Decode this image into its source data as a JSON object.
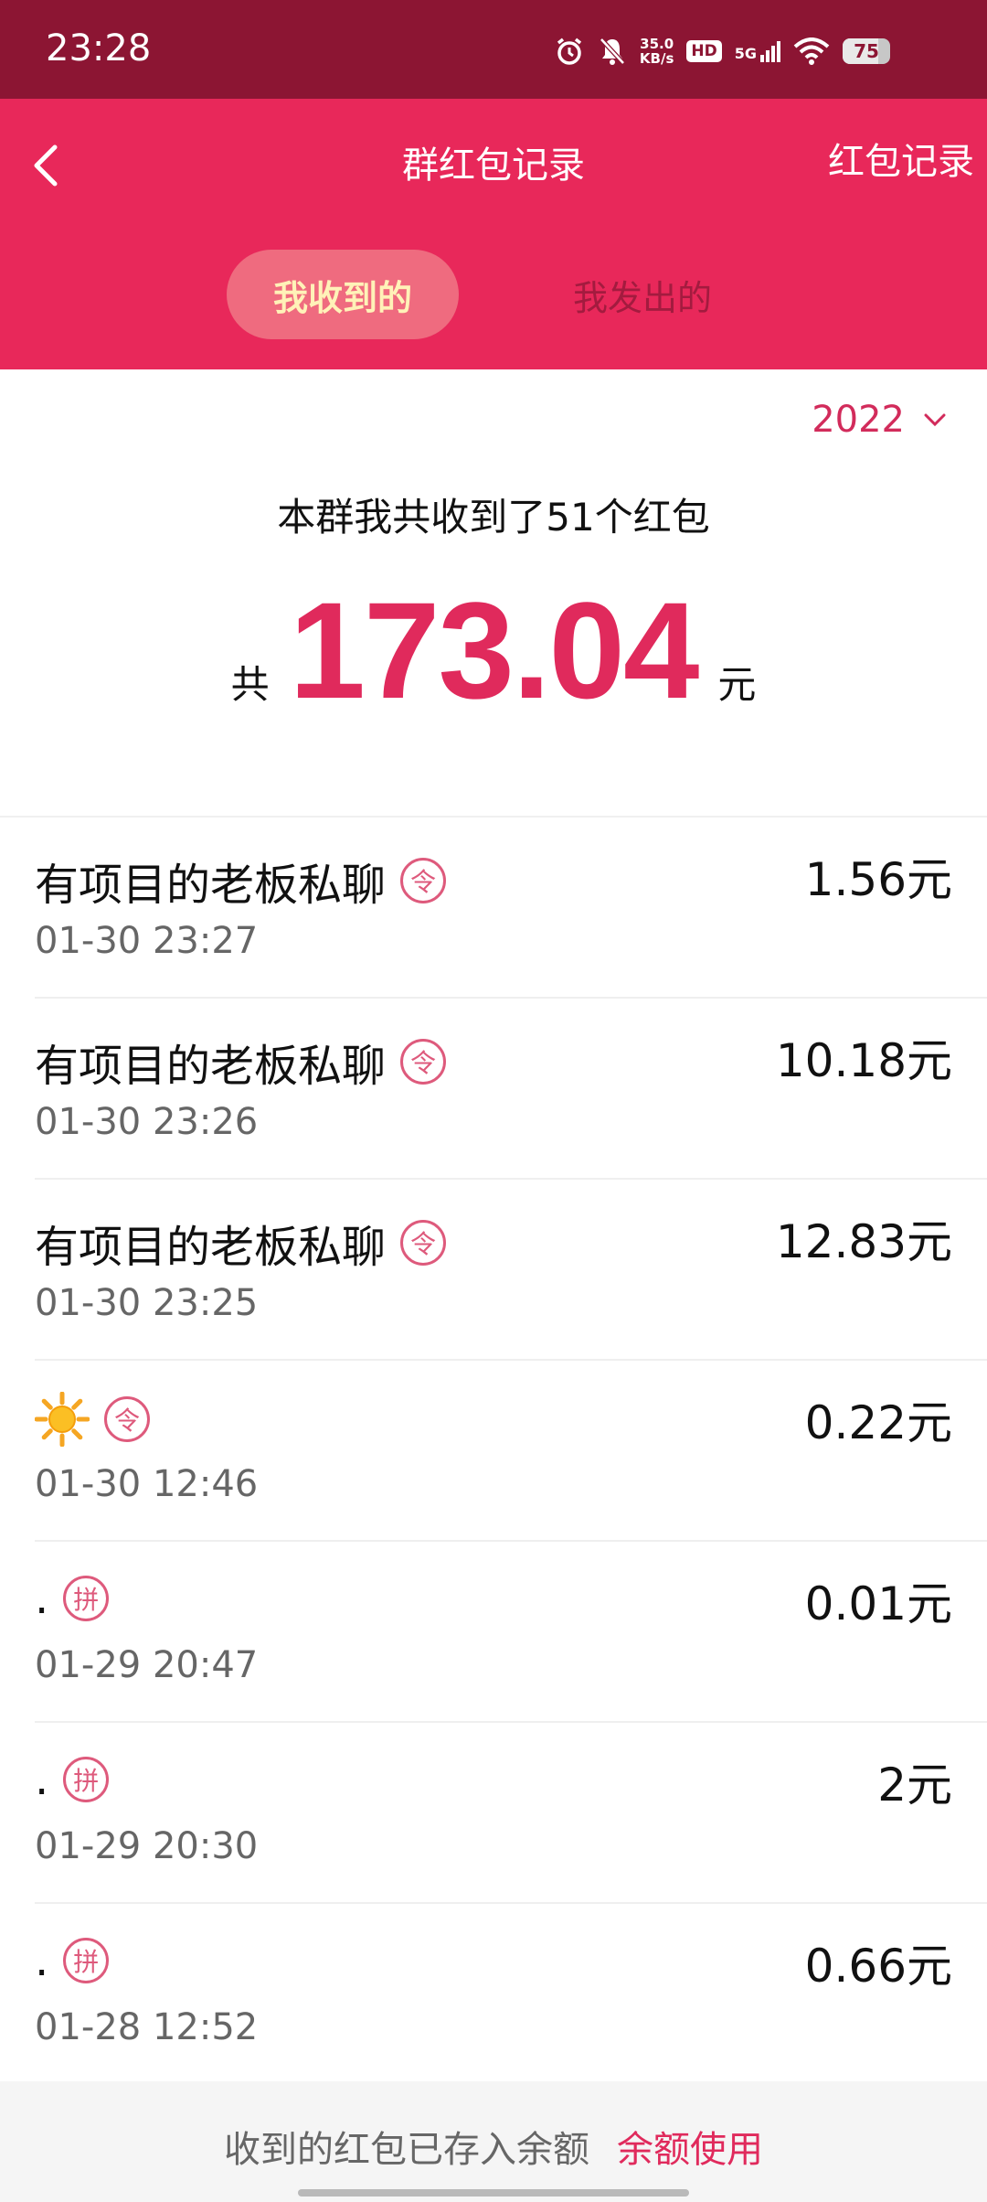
{
  "status_bar": {
    "time": "23:28",
    "speed_value": "35.0",
    "speed_unit": "KB/s",
    "hd": "HD",
    "network": "5G",
    "battery": "75",
    "battery_level_percent": 75
  },
  "header": {
    "title": "群红包记录",
    "records_link": "红包记录",
    "tabs": [
      {
        "label": "我收到的",
        "active": true
      },
      {
        "label": "我发出的",
        "active": false
      }
    ]
  },
  "summary": {
    "year": "2022",
    "text": "本群我共收到了51个红包",
    "total_prefix": "共",
    "total_amount": "173.04",
    "total_suffix": "元"
  },
  "records": [
    {
      "name": "有项目的老板私聊",
      "emoji": "",
      "badge": "令",
      "time": "01-30 23:27",
      "amount": "1.56元"
    },
    {
      "name": "有项目的老板私聊",
      "emoji": "",
      "badge": "令",
      "time": "01-30 23:26",
      "amount": "10.18元"
    },
    {
      "name": "有项目的老板私聊",
      "emoji": "",
      "badge": "令",
      "time": "01-30 23:25",
      "amount": "12.83元"
    },
    {
      "name": "",
      "emoji": "sun",
      "badge": "令",
      "time": "01-30 12:46",
      "amount": "0.22元"
    },
    {
      "name": ".",
      "emoji": "",
      "badge": "拼",
      "time": "01-29 20:47",
      "amount": "0.01元"
    },
    {
      "name": ".",
      "emoji": "",
      "badge": "拼",
      "time": "01-29 20:30",
      "amount": "2元"
    },
    {
      "name": ".",
      "emoji": "",
      "badge": "拼",
      "time": "01-28 12:52",
      "amount": "0.66元"
    }
  ],
  "footer": {
    "note": "收到的红包已存入余额",
    "link": "余额使用"
  },
  "colors": {
    "status_bar": "#8c1533",
    "header": "#e8285a",
    "accent": "#e02a5c",
    "active_tab_bg": "#ef6b7f",
    "active_tab_text": "#fff2b8"
  }
}
